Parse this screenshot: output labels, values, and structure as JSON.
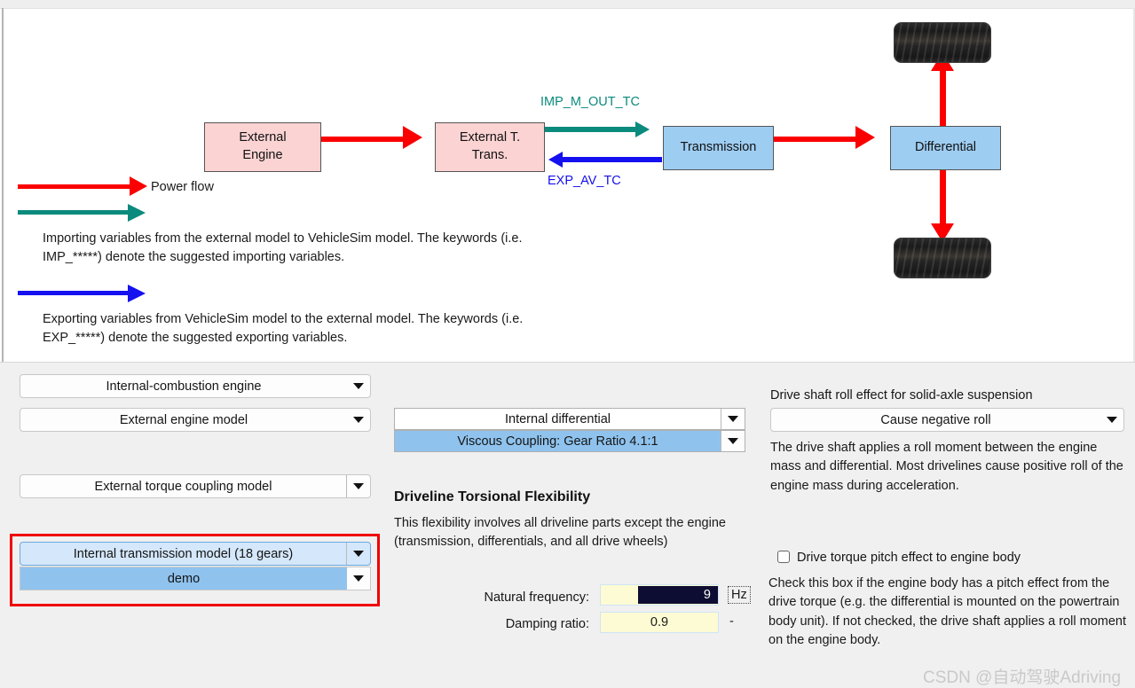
{
  "diagram": {
    "nodes": [
      {
        "id": "external-engine",
        "label": "External\nEngine"
      },
      {
        "id": "external-t-trans",
        "label": "External T.\nTrans."
      },
      {
        "id": "transmission",
        "label": "Transmission"
      },
      {
        "id": "differential",
        "label": "Differential"
      }
    ],
    "signal_labels": {
      "import": "IMP_M_OUT_TC",
      "export": "EXP_AV_TC"
    },
    "legend": {
      "power_flow": "Power flow",
      "import_text": "Importing variables from the external model to VehicleSim model. The keywords (i.e. IMP_*****) denote the suggested importing variables.",
      "export_text": "Exporting variables from VehicleSim model to the external model. The keywords (i.e. EXP_*****) denote the suggested exporting variables."
    },
    "colors": {
      "power_flow": "#fb0000",
      "import_arrow": "#0b8a7e",
      "export_arrow": "#1510ef",
      "engine_box": "#fbd3d3",
      "driveline_box": "#9ecdf2"
    }
  },
  "panel": {
    "left_column": {
      "engine_type": "Internal-combustion engine",
      "engine_model": "External engine model",
      "torque_coupling": "External torque coupling model",
      "transmission_model": "Internal transmission model (18 gears)",
      "transmission_dataset": "demo"
    },
    "middle_column": {
      "differential_type": "Internal differential",
      "differential_dataset": "Viscous Coupling: Gear Ratio 4.1:1",
      "section_title": "Driveline Torsional Flexibility",
      "section_description": "This flexibility involves all driveline parts except the engine (transmission, differentials, and all drive wheels)",
      "natural_frequency_label": "Natural frequency:",
      "natural_frequency_value": "9",
      "natural_frequency_unit": "Hz",
      "damping_ratio_label": "Damping ratio:",
      "damping_ratio_value": "0.9",
      "damping_ratio_unit": "-"
    },
    "right_column": {
      "roll_effect_label": "Drive shaft roll effect for solid-axle suspension",
      "roll_effect_value": "Cause negative roll",
      "roll_effect_description": "The drive shaft applies a roll moment between the engine mass and differential.  Most drivelines cause positive roll of the engine mass during acceleration.",
      "pitch_checkbox_label": "Drive torque pitch effect to engine body",
      "pitch_checkbox_checked": false,
      "pitch_description": "Check this box if the engine body has a pitch effect from the drive torque (e.g. the differential is mounted on the powertrain body unit). If not checked, the drive shaft applies a roll moment on the engine body."
    },
    "highlight_color": "#f00000"
  },
  "watermark": "CSDN @自动驾驶Adriving"
}
